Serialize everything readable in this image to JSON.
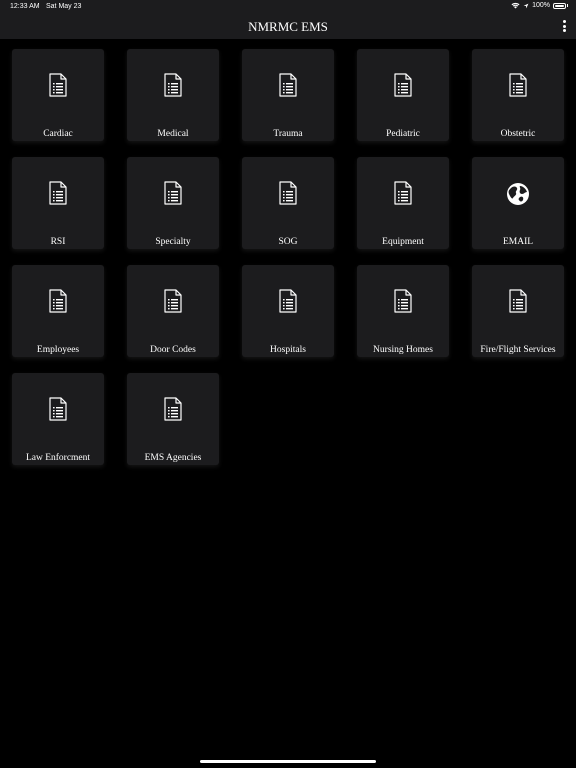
{
  "status": {
    "time": "12:33 AM",
    "date": "Sat May 23",
    "battery": "100%"
  },
  "nav": {
    "title": "NMRMC EMS",
    "menu_icon": "more-vertical-icon"
  },
  "tiles": [
    {
      "label": "Cardiac",
      "icon": "document-icon"
    },
    {
      "label": "Medical",
      "icon": "document-icon"
    },
    {
      "label": "Trauma",
      "icon": "document-icon"
    },
    {
      "label": "Pediatric",
      "icon": "document-icon"
    },
    {
      "label": "Obstetric",
      "icon": "document-icon"
    },
    {
      "label": "RSI",
      "icon": "document-icon"
    },
    {
      "label": "Specialty",
      "icon": "document-icon"
    },
    {
      "label": "SOG",
      "icon": "document-icon"
    },
    {
      "label": "Equipment",
      "icon": "document-icon"
    },
    {
      "label": "EMAIL",
      "icon": "globe-icon"
    },
    {
      "label": "Employees",
      "icon": "document-icon"
    },
    {
      "label": "Door Codes",
      "icon": "document-icon"
    },
    {
      "label": "Hospitals",
      "icon": "document-icon"
    },
    {
      "label": "Nursing Homes",
      "icon": "document-icon"
    },
    {
      "label": "Fire/Flight Services",
      "icon": "document-icon"
    },
    {
      "label": "Law Enforcment",
      "icon": "document-icon"
    },
    {
      "label": "EMS Agencies",
      "icon": "document-icon"
    }
  ],
  "colors": {
    "background": "#000000",
    "bar": "#1c1c1e",
    "tile": "#1c1c1e",
    "text": "#ffffff"
  }
}
